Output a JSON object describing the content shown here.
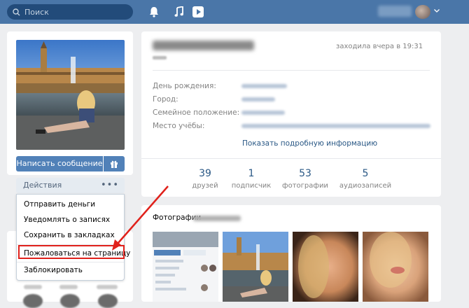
{
  "topbar": {
    "search_placeholder": "Поиск",
    "bell_icon": "bell-icon",
    "music_icon": "music-icon",
    "play_icon": "play-icon"
  },
  "profile": {
    "message_button": "Написать сообщение",
    "actions_label": "Действия",
    "actions_dots": "•••"
  },
  "actions_menu": {
    "items": [
      "Отправить деньги",
      "Уведомлять о записях",
      "Сохранить в закладках",
      "Пожаловаться на страницу",
      "Заблокировать"
    ]
  },
  "info": {
    "last_seen": "заходила вчера в 19:31",
    "fields": [
      "День рождения:",
      "Город:",
      "Семейное положение:",
      "Место учёбы:"
    ],
    "show_more": "Показать подробную информацию"
  },
  "counters": [
    {
      "value": "39",
      "label": "друзей"
    },
    {
      "value": "1",
      "label": "подписчик"
    },
    {
      "value": "53",
      "label": "фотографии"
    },
    {
      "value": "5",
      "label": "аудиозаписей"
    }
  ],
  "photos": {
    "title": "Фотографии"
  },
  "colors": {
    "header_blue": "#4a76a8",
    "button_blue": "#5181b8",
    "link_blue": "#2a5885",
    "highlight_red": "#e0211b"
  }
}
